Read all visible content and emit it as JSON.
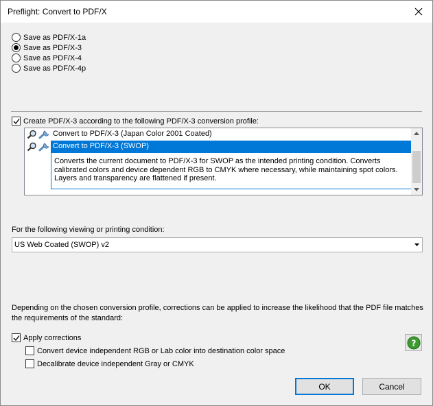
{
  "window": {
    "title": "Preflight: Convert to PDF/X"
  },
  "options": {
    "radios": [
      {
        "label": "Save as PDF/X-1a",
        "checked": false
      },
      {
        "label": "Save as PDF/X-3",
        "checked": true
      },
      {
        "label": "Save as PDF/X-4",
        "checked": false
      },
      {
        "label": "Save as PDF/X-4p",
        "checked": false
      }
    ]
  },
  "profile": {
    "create_label": "Create PDF/X-3 according to the following PDF/X-3 conversion profile:",
    "create_checked": true,
    "items": [
      {
        "label": "Convert to PDF/X-3 (Japan Color 2001 Coated)",
        "selected": false
      },
      {
        "label": "Convert to PDF/X-3 (SWOP)",
        "selected": true
      }
    ],
    "description": "Converts the current document to PDF/X-3 for SWOP as the intended printing condition. Converts calibrated colors and device dependent RGB to CMYK where necessary, while maintaining spot colors. Layers and transparency are flattened if present."
  },
  "condition": {
    "label": "For the following viewing or printing condition:",
    "selected": "US Web Coated (SWOP) v2"
  },
  "corrections": {
    "info": "Depending on the chosen conversion profile, corrections can be applied to increase the likelihood that the PDF file matches the requirements of the standard:",
    "apply_label": "Apply corrections",
    "apply_checked": true,
    "convert_label": "Convert device independent RGB or Lab color into destination color space",
    "convert_checked": false,
    "decalibrate_label": "Decalibrate device independent Gray or CMYK",
    "decalibrate_checked": false
  },
  "buttons": {
    "ok": "OK",
    "cancel": "Cancel",
    "help": "?"
  },
  "colors": {
    "accent": "#0078d7",
    "help_green": "#3c9a2e"
  }
}
